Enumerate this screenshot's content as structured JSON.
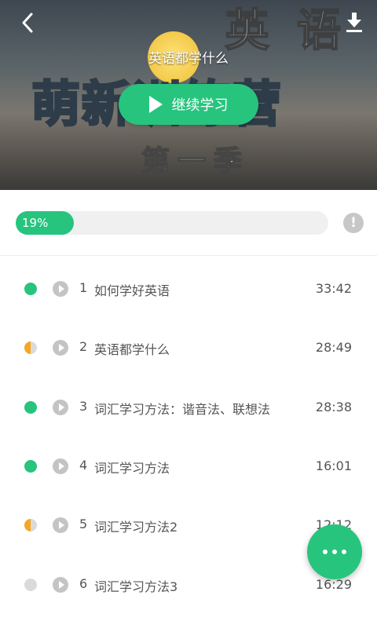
{
  "header": {
    "title": "英语都学什么",
    "continue_label": "继续学习",
    "cover_text": {
      "en": "英 语",
      "main": "萌新训练营",
      "season": "第一季"
    }
  },
  "progress": {
    "percent_label": "19%",
    "value": 0.19,
    "info_glyph": "!"
  },
  "lessons": [
    {
      "num": "1",
      "title": "如何学好英语",
      "duration": "33:42",
      "status": "done"
    },
    {
      "num": "2",
      "title": "英语都学什么",
      "duration": "28:49",
      "status": "partial"
    },
    {
      "num": "3",
      "title": "词汇学习方法：谐音法、联想法",
      "duration": "28:38",
      "status": "done"
    },
    {
      "num": "4",
      "title": "词汇学习方法",
      "duration": "16:01",
      "status": "done"
    },
    {
      "num": "5",
      "title": "词汇学习方法2",
      "duration": "12:12",
      "status": "partial"
    },
    {
      "num": "6",
      "title": "词汇学习方法3",
      "duration": "16:29",
      "status": "new"
    }
  ],
  "colors": {
    "accent": "#27c47e",
    "partial": "#f5a623",
    "inactive": "#dadada"
  },
  "icons": {
    "back": "chevron-left-icon",
    "download": "download-icon",
    "info": "info-icon",
    "more": "more-dots-icon",
    "play": "play-icon"
  }
}
